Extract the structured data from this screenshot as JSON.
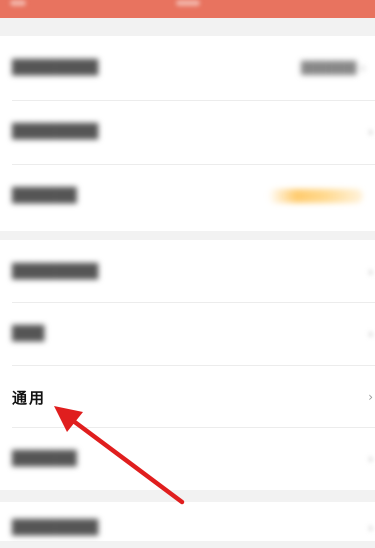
{
  "header": {
    "title": ""
  },
  "settings": {
    "general_label": "通用",
    "chevron": "›"
  },
  "colors": {
    "header": "#e8735f",
    "arrow": "#e01e1e",
    "background": "#f2f2f2"
  }
}
